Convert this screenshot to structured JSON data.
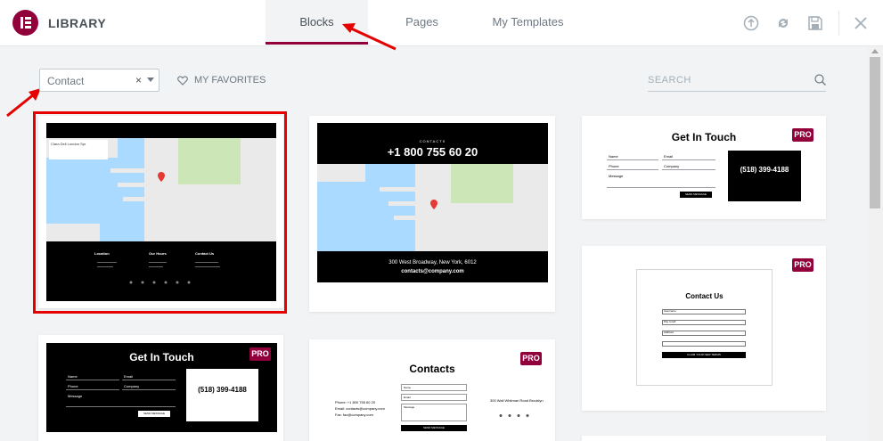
{
  "header": {
    "app_title": "LIBRARY",
    "tabs": [
      {
        "label": "Blocks",
        "active": true
      },
      {
        "label": "Pages",
        "active": false
      },
      {
        "label": "My Templates",
        "active": false
      }
    ],
    "icons": [
      "upload-icon",
      "sync-icon",
      "save-icon",
      "close-icon"
    ]
  },
  "filter": {
    "category_value": "Contact",
    "clear_symbol": "×"
  },
  "favorites": {
    "label": "MY FAVORITES"
  },
  "search": {
    "placeholder": "SEARCH"
  },
  "badge": {
    "pro_label": "PRO"
  },
  "colors": {
    "accent": "#92003b",
    "highlight": "#e60000"
  },
  "cards": {
    "map_footer": {
      "columns": [
        "Location",
        "Our Hours",
        "Contact Us"
      ],
      "map_place": "Clara Deli London Spr"
    },
    "map_phone": {
      "kicker": "CONTACTS",
      "phone": "+1 800 755 60 20",
      "address": "300 West Broadway, New York, 6012",
      "email": "contacts@company.com"
    },
    "get_in_touch_white": {
      "title": "Get In Touch",
      "phone": "(518) 399-4188",
      "fields": [
        "Name",
        "Email",
        "Phone",
        "Company",
        "Message"
      ],
      "button": "SEND MESSAGE"
    },
    "contact_us_form": {
      "title": "Contact Us",
      "fields": [
        "Username",
        "Pay to left",
        "Address"
      ],
      "button": "CLAIM YOUR NEW TERMS"
    },
    "get_in_touch_black": {
      "title": "Get In Touch",
      "phone": "(518) 399-4188",
      "fields": [
        "Name",
        "Email",
        "Phone",
        "Company",
        "Message"
      ],
      "button": "SEND MESSAGE"
    },
    "contacts_white": {
      "title": "Contacts",
      "info": [
        "Phone: +1 800 755 60 20",
        "Email: contacts@company.com",
        "Fax: fax@company.com"
      ],
      "address": "300 Wall Whitman Road Brooklyn",
      "fields": [
        "Name",
        "Email",
        "Message"
      ],
      "button": "SEND MESSAGE"
    }
  }
}
